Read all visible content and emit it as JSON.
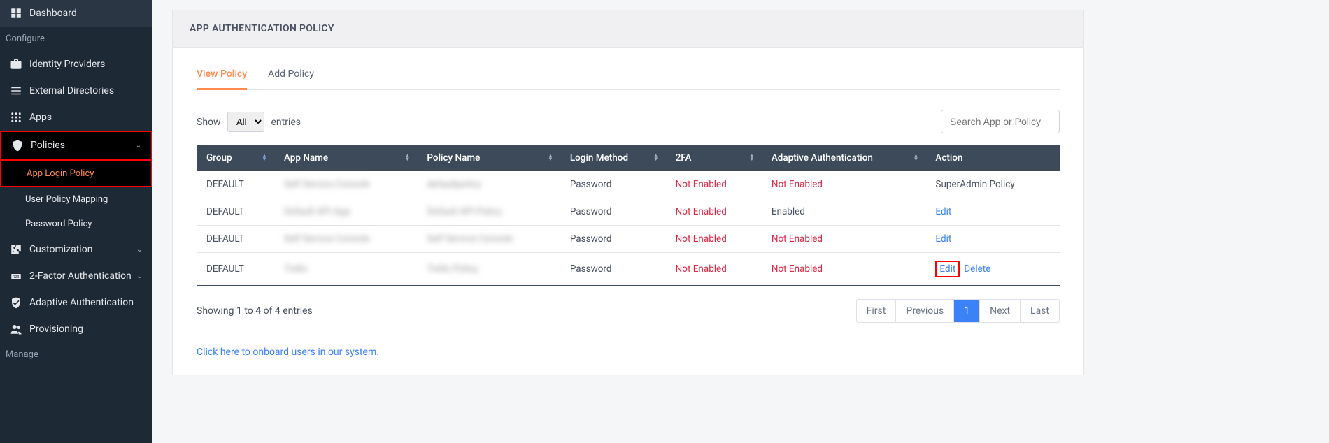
{
  "sidebar": {
    "items": [
      {
        "icon": "dashboard",
        "label": "Dashboard"
      },
      {
        "section_label": "Configure"
      },
      {
        "icon": "briefcase",
        "label": "Identity Providers"
      },
      {
        "icon": "list",
        "label": "External Directories"
      },
      {
        "icon": "grid",
        "label": "Apps"
      },
      {
        "icon": "shield",
        "label": "Policies",
        "expandable": true,
        "active": true,
        "highlight": true
      },
      {
        "sub": true,
        "label": "App Login Policy",
        "active": true,
        "highlight": true
      },
      {
        "sub": true,
        "label": "User Policy Mapping"
      },
      {
        "sub": true,
        "label": "Password Policy"
      },
      {
        "icon": "puzzle",
        "label": "Customization",
        "expandable": true
      },
      {
        "icon": "key",
        "label": "2-Factor Authentication",
        "expandable": true
      },
      {
        "icon": "shieldcheck",
        "label": "Adaptive Authentication"
      },
      {
        "icon": "users",
        "label": "Provisioning"
      },
      {
        "section_label": "Manage"
      }
    ]
  },
  "page": {
    "title": "APP AUTHENTICATION POLICY",
    "tabs": [
      {
        "label": "View Policy",
        "active": true
      },
      {
        "label": "Add Policy"
      }
    ],
    "entries": {
      "show_label": "Show",
      "selected": "All",
      "after_label": "entries"
    },
    "search_placeholder": "Search App or Policy",
    "columns": [
      "Group",
      "App Name",
      "Policy Name",
      "Login Method",
      "2FA",
      "Adaptive Authentication",
      "Action"
    ],
    "rows": [
      {
        "group": "DEFAULT",
        "app": "Self Service Console",
        "policy": "defaultpolicy",
        "login": "Password",
        "tfa": "Not Enabled",
        "adaptive": "Not Enabled",
        "action": "SuperAdmin Policy",
        "action_type": "text"
      },
      {
        "group": "DEFAULT",
        "app": "Default API App",
        "policy": "Default API Policy",
        "login": "Password",
        "tfa": "Not Enabled",
        "adaptive": "Enabled",
        "action": "Edit",
        "action_type": "edit"
      },
      {
        "group": "DEFAULT",
        "app": "Self Service Console",
        "policy": "Self Service Console",
        "login": "Password",
        "tfa": "Not Enabled",
        "adaptive": "Not Enabled",
        "action": "Edit",
        "action_type": "edit"
      },
      {
        "group": "DEFAULT",
        "app": "Trello",
        "policy": "Trello Policy",
        "login": "Password",
        "tfa": "Not Enabled",
        "adaptive": "Not Enabled",
        "action": "Edit",
        "delete": "Delete",
        "action_type": "edit-delete-hl"
      }
    ],
    "footer_info": "Showing 1 to 4 of 4 entries",
    "pager": [
      "First",
      "Previous",
      "1",
      "Next",
      "Last"
    ],
    "pager_active": "1",
    "onboard_link": "Click here to onboard users in our system."
  }
}
